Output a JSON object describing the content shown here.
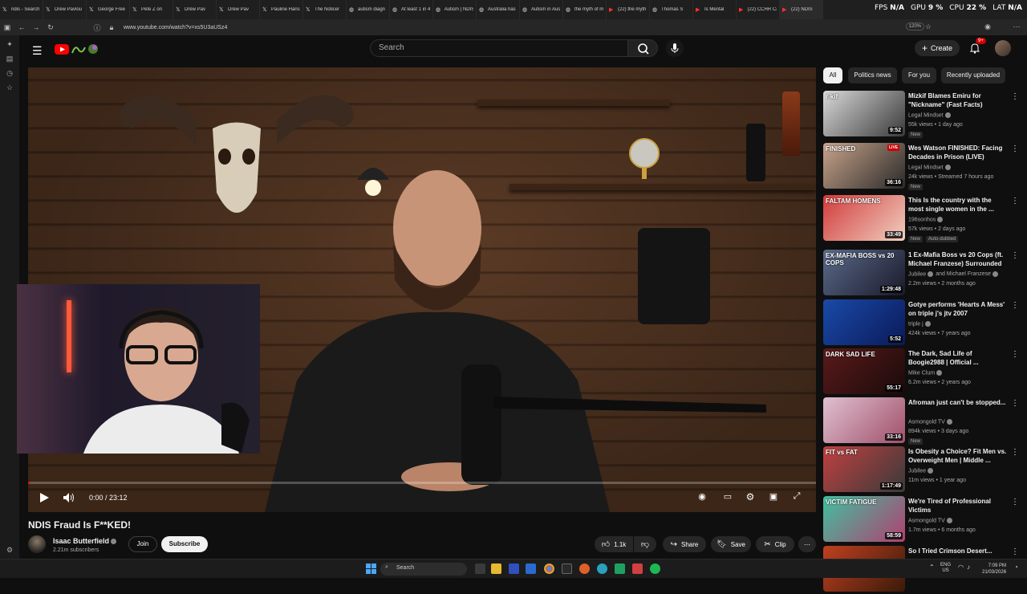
{
  "browser": {
    "tabs": [
      {
        "icon": "x-icon",
        "title": "ndis - Search"
      },
      {
        "icon": "x-icon",
        "title": "Drew Pavlou"
      },
      {
        "icon": "x-icon",
        "title": "George Free"
      },
      {
        "icon": "x-icon",
        "title": "Pete Z on"
      },
      {
        "icon": "x-icon",
        "title": "Drew Pav"
      },
      {
        "icon": "x-icon",
        "title": "Drew Pav"
      },
      {
        "icon": "x-icon",
        "title": "Pauline Hans"
      },
      {
        "icon": "x-icon",
        "title": "The Noticer"
      },
      {
        "icon": "globe-icon",
        "title": "autism diagn"
      },
      {
        "icon": "globe-icon",
        "title": "At least 1 in 4"
      },
      {
        "icon": "globe-icon",
        "title": "Autism | NDIS"
      },
      {
        "icon": "globe-icon",
        "title": "Australia has"
      },
      {
        "icon": "globe-icon",
        "title": "Autism in Aus"
      },
      {
        "icon": "globe-icon",
        "title": "the myth of m"
      },
      {
        "icon": "yt-icon",
        "title": "(22) the myth"
      },
      {
        "icon": "globe-icon",
        "title": "Thomas S"
      },
      {
        "icon": "yt-icon",
        "title": "Is Mental"
      },
      {
        "icon": "yt-icon",
        "title": "(22) CCHR Ca"
      },
      {
        "icon": "yt-icon",
        "title": "(22) NDIS"
      }
    ],
    "perf": {
      "fps_label": "FPS",
      "fps": "N/A",
      "gpu_label": "GPU",
      "gpu": "9 %",
      "cpu_label": "CPU",
      "cpu": "22 %",
      "lat_label": "LAT",
      "lat": "N/A"
    },
    "url": "www.youtube.com/watch?v=xs5U3aUSz4",
    "zoom": "120%"
  },
  "youtube": {
    "search_placeholder": "Search",
    "create_label": "Create",
    "notif_count": "9+",
    "video": {
      "title": "NDIS Fraud Is F**KED!",
      "time": "0:00 / 23:12",
      "progress": 0.002
    },
    "channel": {
      "name": "Isaac Butterfield",
      "subs": "2.21m subscribers"
    },
    "join_label": "Join",
    "subscribe_label": "Subscribe",
    "actions": {
      "likes": "1.1k",
      "share": "Share",
      "save": "Save",
      "clip": "Clip"
    },
    "chips": [
      "All",
      "Politics news",
      "For you",
      "Recently uploaded"
    ],
    "recs": [
      {
        "title": "Mizkif Blames Emiru for \"Nickname\" (Fast Facts)",
        "channel": "Legal Mindset",
        "meta": "55k views • 1 day ago",
        "badge": "New",
        "duration": "9:52",
        "colors": [
          "#d9d9d9",
          "#3a3a3a"
        ],
        "thumb_text": "r-kif"
      },
      {
        "title": "Wes Watson FINISHED: Facing Decades in Prison (LIVE)",
        "channel": "Legal Mindset",
        "meta": "24k views • Streamed 7 hours ago",
        "badge": "New",
        "duration": "36:16",
        "colors": [
          "#c8a38a",
          "#2a2a2a"
        ],
        "thumb_text": "FINISHED",
        "live": "LIVE"
      },
      {
        "title": "This Is the country with the most single women in the ...",
        "channel": "196sonhos",
        "meta": "57k views • 2 days ago",
        "badge": "New",
        "badge2": "Auto-dubbed",
        "duration": "33:49",
        "colors": [
          "#d23a3a",
          "#f0d0c0"
        ],
        "thumb_text": "FALTAM HOMENS"
      },
      {
        "title": "1 Ex-Mafia Boss vs 20 Cops (ft. Michael Franzese) Surrounded",
        "channel": "Jubilee",
        "channel2": "and Michael Franzese",
        "meta": "2.2m views • 2 months ago",
        "duration": "1:29:48",
        "colors": [
          "#5a6a8a",
          "#1a1a2a"
        ],
        "thumb_text": "EX-MAFIA BOSS vs 20 COPS"
      },
      {
        "title": "Gotye performs 'Hearts A Mess' on triple j's jtv 2007",
        "channel": "triple j",
        "meta": "424k views • 7 years ago",
        "duration": "5:52",
        "colors": [
          "#1a4aa8",
          "#0a1a5a"
        ],
        "thumb_text": ""
      },
      {
        "title": "The Dark, Sad Life of Boogie2988 | Official ...",
        "channel": "Mike Clum",
        "meta": "6.2m views • 2 years ago",
        "duration": "55:17",
        "colors": [
          "#5a1a1a",
          "#1a0a0a"
        ],
        "thumb_text": "DARK SAD LIFE"
      },
      {
        "title": "Afroman just can't be stopped...",
        "channel": "Asmongold TV",
        "meta": "894k views • 3 days ago",
        "badge": "New",
        "duration": "33:16",
        "colors": [
          "#e0c0d0",
          "#a0506a"
        ],
        "thumb_text": ""
      },
      {
        "title": "Is Obesity a Choice? Fit Men vs. Overweight Men | Middle ...",
        "channel": "Jubilee",
        "meta": "11m views • 1 year ago",
        "duration": "1:17:49",
        "colors": [
          "#c04040",
          "#3a3a3a"
        ],
        "thumb_text": "FIT vs FAT"
      },
      {
        "title": "We're Tired of Professional Victims",
        "channel": "Asmongold TV",
        "meta": "1.7m views • 6 months ago",
        "duration": "58:59",
        "colors": [
          "#40c0a0",
          "#b04070"
        ],
        "thumb_text": "VICTIM FATIGUE"
      },
      {
        "title": "So I Tried Crimson Desert...",
        "channel": "",
        "meta": "",
        "duration": "",
        "colors": [
          "#c04020",
          "#3a1a0a"
        ],
        "thumb_text": ""
      }
    ]
  },
  "taskbar": {
    "search": "Search",
    "lang": [
      "ENG",
      "US"
    ],
    "time": "7:09 PM",
    "date": "21/03/2026"
  }
}
